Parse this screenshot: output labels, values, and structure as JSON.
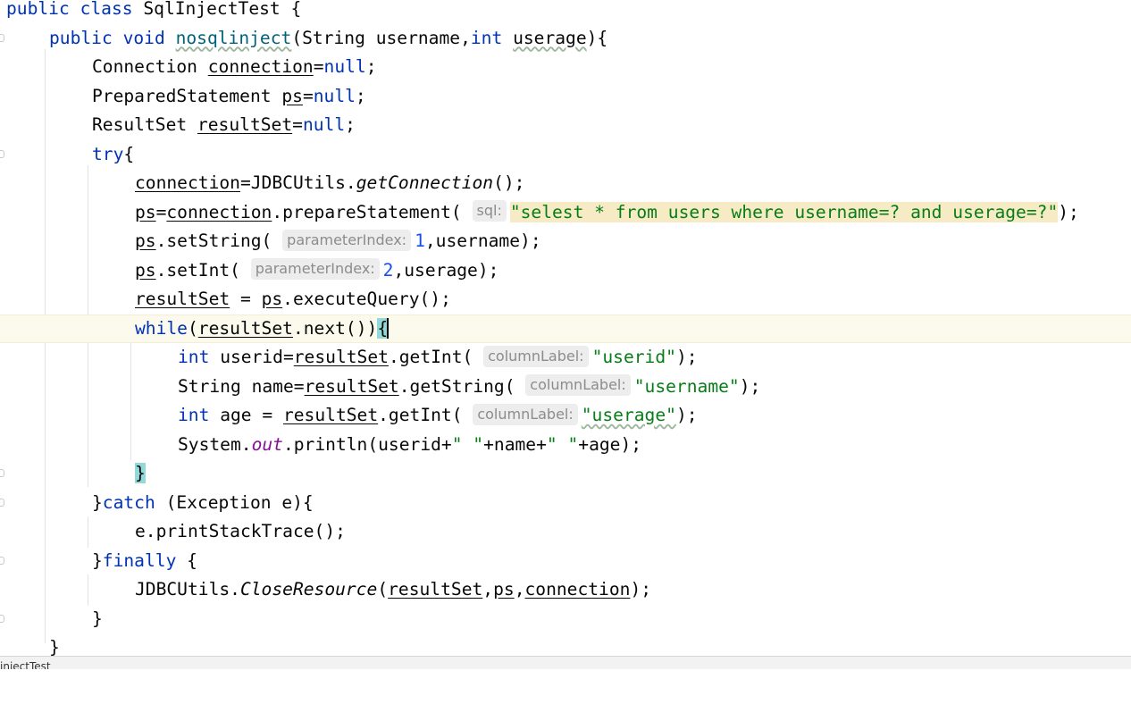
{
  "editor": {
    "class_name": "SqlInjectTest",
    "method_name": "nosqlinject",
    "hints": {
      "sql": "sql:",
      "parameter_index": "parameterIndex:",
      "column_label": "columnLabel:"
    },
    "strings": {
      "sql_query": "\"selest * from users where username=? and userage=?\"",
      "userid": "\"userid\"",
      "username": "\"username\"",
      "userage": "\"userage\"",
      "space": "\" \""
    },
    "numbers": {
      "index_1": "1",
      "index_2": "2"
    },
    "status_tab": "injectTest"
  }
}
